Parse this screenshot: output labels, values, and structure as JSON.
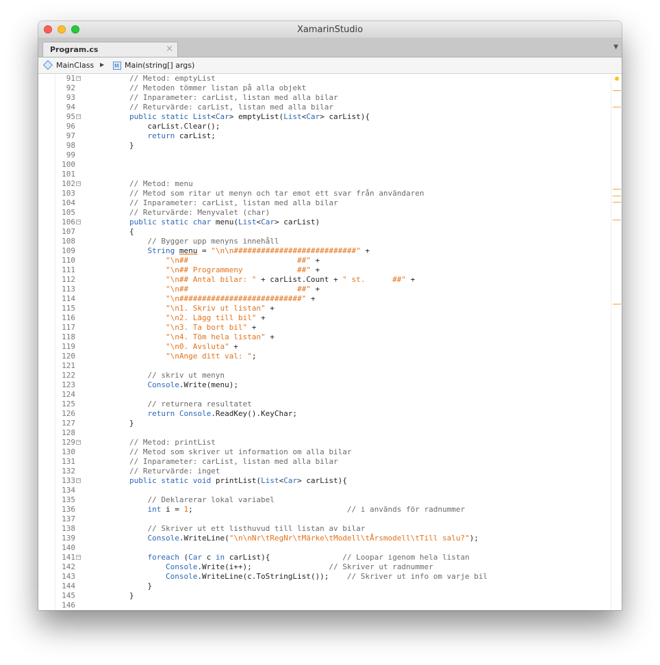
{
  "window": {
    "title": "XamarinStudio"
  },
  "tab": {
    "label": "Program.cs",
    "close_glyph": "×",
    "menu_glyph": "▼"
  },
  "breadcrumb": {
    "class_name": "MainClass",
    "class_icon": "class-icon",
    "separator": "▶",
    "method_name": "Main(string[] args)",
    "method_icon": "method-icon"
  },
  "colors": {
    "keyword": "#2a66b8",
    "string": "#e2721a",
    "comment": "#6a6a6a",
    "scroll_marker": "#f4a23c"
  },
  "editor": {
    "line_numbers": [
      "91",
      "92",
      "93",
      "94",
      "95",
      "96",
      "97",
      "98",
      "99",
      "100",
      "101",
      "102",
      "103",
      "104",
      "105",
      "106",
      "107",
      "108",
      "109",
      "110",
      "111",
      "112",
      "113",
      "114",
      "115",
      "116",
      "117",
      "118",
      "119",
      "120",
      "121",
      "122",
      "123",
      "124",
      "125",
      "126",
      "127",
      "128",
      "129",
      "130",
      "131",
      "132",
      "133",
      "134",
      "135",
      "136",
      "137",
      "138",
      "139",
      "140",
      "141",
      "142",
      "143",
      "144",
      "145",
      "146"
    ],
    "fold_lines": [
      "91",
      "95",
      "102",
      "106",
      "129",
      "133",
      "141"
    ],
    "lines": [
      [
        [
          "c",
          "        // Metod: emptyList"
        ]
      ],
      [
        [
          "c",
          "        // Metoden tömmer listan på alla objekt"
        ]
      ],
      [
        [
          "c",
          "        // Inparameter: carList, listan med alla bilar"
        ]
      ],
      [
        [
          "c",
          "        // Returvärde: carList, listan med alla bilar"
        ]
      ],
      [
        [
          "p",
          "        "
        ],
        [
          "k",
          "public static "
        ],
        [
          "t",
          "List"
        ],
        [
          "p",
          "<"
        ],
        [
          "t",
          "Car"
        ],
        [
          "p",
          "> emptyList("
        ],
        [
          "t",
          "List"
        ],
        [
          "p",
          "<"
        ],
        [
          "t",
          "Car"
        ],
        [
          "p",
          "> carList){"
        ]
      ],
      [
        [
          "p",
          "            carList.Clear();"
        ]
      ],
      [
        [
          "p",
          "            "
        ],
        [
          "k",
          "return"
        ],
        [
          "p",
          " carList;"
        ]
      ],
      [
        [
          "p",
          "        }"
        ]
      ],
      [
        [
          "p",
          ""
        ]
      ],
      [
        [
          "p",
          ""
        ]
      ],
      [
        [
          "p",
          ""
        ]
      ],
      [
        [
          "c",
          "        // Metod: menu"
        ]
      ],
      [
        [
          "c",
          "        // Metod som ritar ut menyn och tar emot ett svar från användaren"
        ]
      ],
      [
        [
          "c",
          "        // Inparameter: carList, listan med alla bilar"
        ]
      ],
      [
        [
          "c",
          "        // Returvärde: Menyvalet (char)"
        ]
      ],
      [
        [
          "p",
          "        "
        ],
        [
          "k",
          "public static char "
        ],
        [
          "p",
          "menu("
        ],
        [
          "t",
          "List"
        ],
        [
          "p",
          "<"
        ],
        [
          "t",
          "Car"
        ],
        [
          "p",
          "> carList)"
        ]
      ],
      [
        [
          "p",
          "        {"
        ]
      ],
      [
        [
          "c",
          "            // Bygger upp menyns innehåll"
        ]
      ],
      [
        [
          "p",
          "            "
        ],
        [
          "t",
          "String"
        ],
        [
          "p",
          " "
        ],
        [
          "u",
          "menu"
        ],
        [
          "p",
          " = "
        ],
        [
          "s",
          "\"\\n\\n###########################\""
        ],
        [
          "p",
          " +"
        ]
      ],
      [
        [
          "p",
          "                "
        ],
        [
          "s",
          "\"\\n##                        ##\""
        ],
        [
          "p",
          " +"
        ]
      ],
      [
        [
          "p",
          "                "
        ],
        [
          "s",
          "\"\\n## Programmeny            ##\""
        ],
        [
          "p",
          " +"
        ]
      ],
      [
        [
          "p",
          "                "
        ],
        [
          "s",
          "\"\\n## Antal bilar: \""
        ],
        [
          "p",
          " + carList.Count + "
        ],
        [
          "s",
          "\" st.      ##\""
        ],
        [
          "p",
          " +"
        ]
      ],
      [
        [
          "p",
          "                "
        ],
        [
          "s",
          "\"\\n##                        ##\""
        ],
        [
          "p",
          " +"
        ]
      ],
      [
        [
          "p",
          "                "
        ],
        [
          "s",
          "\"\\n###########################\""
        ],
        [
          "p",
          " +"
        ]
      ],
      [
        [
          "p",
          "                "
        ],
        [
          "s",
          "\"\\n1. Skriv ut listan\""
        ],
        [
          "p",
          " +"
        ]
      ],
      [
        [
          "p",
          "                "
        ],
        [
          "s",
          "\"\\n2. Lägg till bil\""
        ],
        [
          "p",
          " +"
        ]
      ],
      [
        [
          "p",
          "                "
        ],
        [
          "s",
          "\"\\n3. Ta bort bil\""
        ],
        [
          "p",
          " +"
        ]
      ],
      [
        [
          "p",
          "                "
        ],
        [
          "s",
          "\"\\n4. Töm hela listan\""
        ],
        [
          "p",
          " +"
        ]
      ],
      [
        [
          "p",
          "                "
        ],
        [
          "s",
          "\"\\n0. Avsluta\""
        ],
        [
          "p",
          " +"
        ]
      ],
      [
        [
          "p",
          "                "
        ],
        [
          "s",
          "\"\\nAnge ditt val: \""
        ],
        [
          "p",
          ";"
        ]
      ],
      [
        [
          "p",
          ""
        ]
      ],
      [
        [
          "c",
          "            // skriv ut menyn"
        ]
      ],
      [
        [
          "p",
          "            "
        ],
        [
          "t",
          "Console"
        ],
        [
          "p",
          ".Write(menu);"
        ]
      ],
      [
        [
          "p",
          ""
        ]
      ],
      [
        [
          "c",
          "            // returnera resultatet"
        ]
      ],
      [
        [
          "p",
          "            "
        ],
        [
          "k",
          "return "
        ],
        [
          "t",
          "Console"
        ],
        [
          "p",
          ".ReadKey().KeyChar;"
        ]
      ],
      [
        [
          "p",
          "        }"
        ]
      ],
      [
        [
          "p",
          ""
        ]
      ],
      [
        [
          "c",
          "        // Metod: printList"
        ]
      ],
      [
        [
          "c",
          "        // Metod som skriver ut information om alla bilar"
        ]
      ],
      [
        [
          "c",
          "        // Inparameter: carList, listan med alla bilar"
        ]
      ],
      [
        [
          "c",
          "        // Returvärde: inget"
        ]
      ],
      [
        [
          "p",
          "        "
        ],
        [
          "k",
          "public static void "
        ],
        [
          "p",
          "printList("
        ],
        [
          "t",
          "List"
        ],
        [
          "p",
          "<"
        ],
        [
          "t",
          "Car"
        ],
        [
          "p",
          "> carList){"
        ]
      ],
      [
        [
          "p",
          ""
        ]
      ],
      [
        [
          "c",
          "            // Deklarerar lokal variabel"
        ]
      ],
      [
        [
          "p",
          "            "
        ],
        [
          "k",
          "int"
        ],
        [
          "p",
          " i = "
        ],
        [
          "n",
          "1"
        ],
        [
          "p",
          ";                                  "
        ],
        [
          "c",
          "// i används för radnummer"
        ]
      ],
      [
        [
          "p",
          ""
        ]
      ],
      [
        [
          "c",
          "            // Skriver ut ett listhuvud till listan av bilar"
        ]
      ],
      [
        [
          "p",
          "            "
        ],
        [
          "t",
          "Console"
        ],
        [
          "p",
          ".WriteLine("
        ],
        [
          "s",
          "\"\\n\\nNr\\tRegNr\\tMärke\\tModell\\tÅrsmodell\\tTill salu?\""
        ],
        [
          "p",
          ");"
        ]
      ],
      [
        [
          "p",
          ""
        ]
      ],
      [
        [
          "p",
          "            "
        ],
        [
          "k",
          "foreach"
        ],
        [
          "p",
          " ("
        ],
        [
          "t",
          "Car"
        ],
        [
          "p",
          " c "
        ],
        [
          "k",
          "in"
        ],
        [
          "p",
          " carList){                "
        ],
        [
          "c",
          "// Loopar igenom hela listan"
        ]
      ],
      [
        [
          "p",
          "                "
        ],
        [
          "t",
          "Console"
        ],
        [
          "p",
          ".Write(i++);                 "
        ],
        [
          "c",
          "// Skriver ut radnummer"
        ]
      ],
      [
        [
          "p",
          "                "
        ],
        [
          "t",
          "Console"
        ],
        [
          "p",
          ".WriteLine(c.ToStringList());    "
        ],
        [
          "c",
          "// Skriver ut info om varje bil"
        ]
      ],
      [
        [
          "p",
          "            }"
        ]
      ],
      [
        [
          "p",
          "        }"
        ]
      ],
      [
        [
          "p",
          ""
        ]
      ]
    ]
  }
}
